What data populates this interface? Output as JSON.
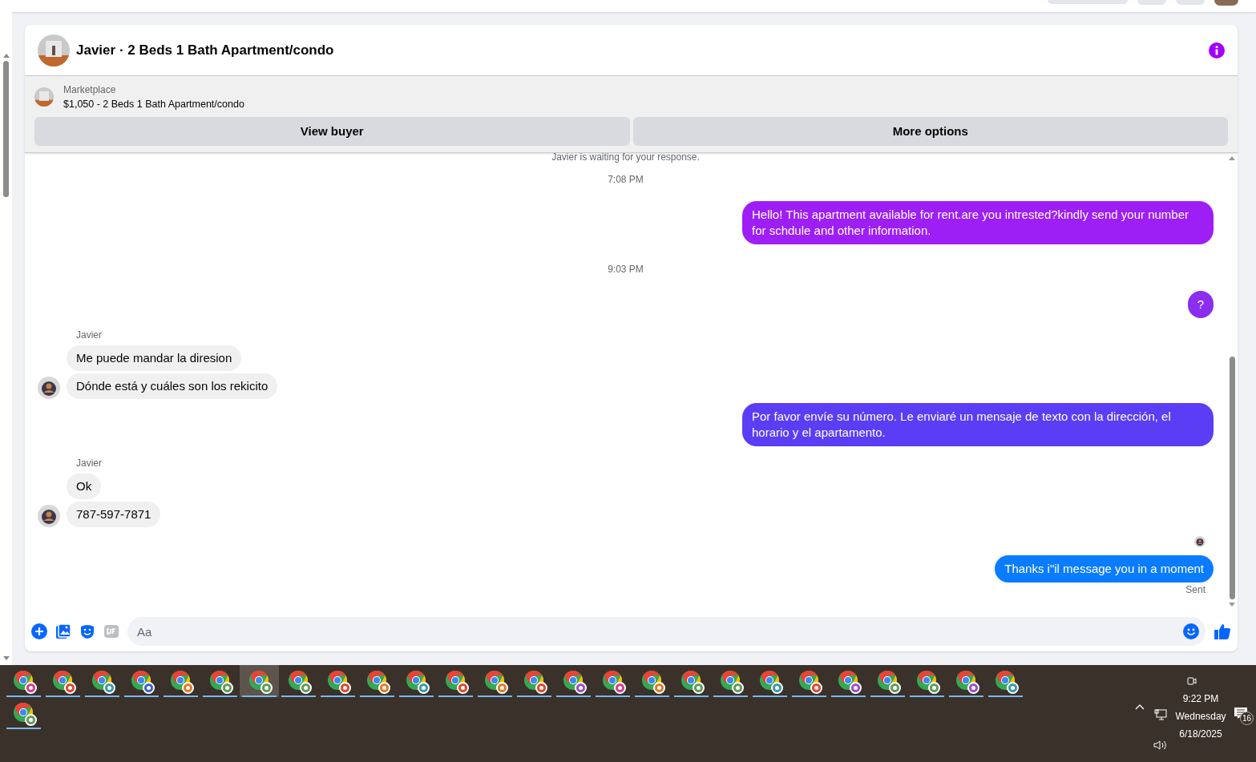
{
  "conversation": {
    "title": "Javier · 2 Beds 1 Bath Apartment/condo"
  },
  "listing": {
    "source": "Marketplace",
    "summary": "$1,050 - 2 Beds 1 Bath Apartment/condo",
    "buttons": [
      "View buyer",
      "More options"
    ]
  },
  "messages": [
    {
      "kind": "notice",
      "text": "Javier is waiting for your response."
    },
    {
      "kind": "time",
      "text": "7:08 PM"
    },
    {
      "kind": "outgoing",
      "text": "Hello! This apartment available for rent.are you intrested?kindly send your number for schdule and other information.",
      "color": "#9d1ff5"
    },
    {
      "kind": "time",
      "text": "9:03 PM"
    },
    {
      "kind": "outgoing",
      "text": "?",
      "color": "#8a2ef0"
    },
    {
      "kind": "sender",
      "text": "Javier"
    },
    {
      "kind": "incoming",
      "text": "Me puede mandar la diresion",
      "avatar": false
    },
    {
      "kind": "incoming",
      "text": "Dónde está y cuáles son los rekicito",
      "avatar": true
    },
    {
      "kind": "outgoing",
      "text": "Por favor envíe su número. Le enviaré un mensaje de texto con la dirección, el horario y el apartamento.",
      "color": "#5b3df5"
    },
    {
      "kind": "sender",
      "text": "Javier"
    },
    {
      "kind": "incoming",
      "text": "Ok",
      "avatar": false
    },
    {
      "kind": "incoming",
      "text": "787-597-7871",
      "avatar": true
    },
    {
      "kind": "seen"
    },
    {
      "kind": "outgoing",
      "text": "Thanks i\"il message you in a moment",
      "color": "#0a7cff"
    },
    {
      "kind": "status",
      "text": "Sent"
    }
  ],
  "composer": {
    "placeholder": "Aa"
  },
  "taskbar": {
    "apps": [
      {
        "color": "#d63a8c",
        "selected": false
      },
      {
        "color": "#e0462c",
        "selected": false
      },
      {
        "color": "#3a9aa8",
        "selected": false
      },
      {
        "color": "#3d5fc8",
        "selected": false
      },
      {
        "color": "#e07a23",
        "selected": false
      },
      {
        "color": "#5f9a5a",
        "selected": false
      },
      {
        "color": "#5f9a5a",
        "selected": true
      },
      {
        "color": "#5f9a5a",
        "selected": false
      },
      {
        "color": "#e0462c",
        "selected": false
      },
      {
        "color": "#e07a23",
        "selected": false
      },
      {
        "color": "#3a9aa8",
        "selected": false
      },
      {
        "color": "#e0462c",
        "selected": false
      },
      {
        "color": "#e07a23",
        "selected": false
      },
      {
        "color": "#e0462c",
        "selected": false
      },
      {
        "color": "#9a4fc8",
        "selected": false
      },
      {
        "color": "#d63a8c",
        "selected": false
      },
      {
        "color": "#e07a23",
        "selected": false
      },
      {
        "color": "#5f9a5a",
        "selected": false
      },
      {
        "color": "#5f9a5a",
        "selected": false
      },
      {
        "color": "#3a9aa8",
        "selected": false
      },
      {
        "color": "#e0462c",
        "selected": false
      },
      {
        "color": "#9a4fc8",
        "selected": false
      },
      {
        "color": "#5f9a5a",
        "selected": false
      },
      {
        "color": "#5f9a5a",
        "selected": false
      },
      {
        "color": "#9a4fc8",
        "selected": false
      },
      {
        "color": "#3a9aa8",
        "selected": false
      },
      {
        "color": "#5f9a5a",
        "selected": false
      }
    ],
    "time": "9:22 PM",
    "day": "Wednesday",
    "date": "6/18/2025",
    "notifications": "16"
  }
}
